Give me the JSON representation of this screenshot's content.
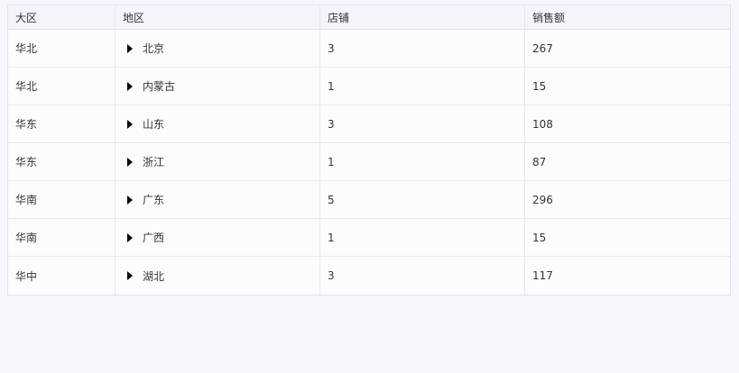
{
  "table": {
    "headers": [
      "大区",
      "地区",
      "店铺",
      "销售额"
    ],
    "rows": [
      {
        "region": "华北",
        "area": "北京",
        "stores": "3",
        "sales": "267"
      },
      {
        "region": "华北",
        "area": "内蒙古",
        "stores": "1",
        "sales": "15"
      },
      {
        "region": "华东",
        "area": "山东",
        "stores": "3",
        "sales": "108"
      },
      {
        "region": "华东",
        "area": "浙江",
        "stores": "1",
        "sales": "87"
      },
      {
        "region": "华南",
        "area": "广东",
        "stores": "5",
        "sales": "296"
      },
      {
        "region": "华南",
        "area": "广西",
        "stores": "1",
        "sales": "15"
      },
      {
        "region": "华中",
        "area": "湖北",
        "stores": "3",
        "sales": "117"
      }
    ]
  },
  "icons": {
    "row_expand": "caret-right-icon"
  }
}
